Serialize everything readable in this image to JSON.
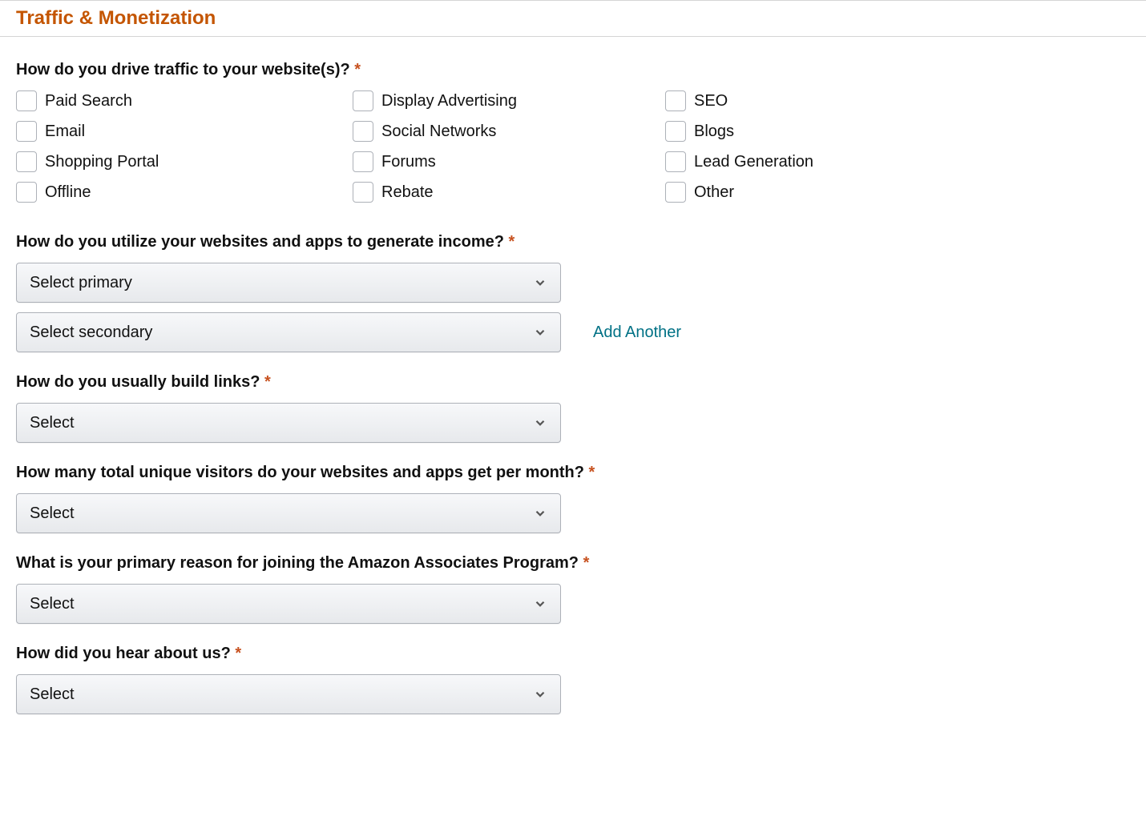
{
  "section": {
    "title": "Traffic & Monetization"
  },
  "traffic": {
    "question": "How do you drive traffic to your website(s)?",
    "required": "*",
    "options": [
      "Paid Search",
      "Display Advertising",
      "SEO",
      "Email",
      "Social Networks",
      "Blogs",
      "Shopping Portal",
      "Forums",
      "Lead Generation",
      "Offline",
      "Rebate",
      "Other"
    ]
  },
  "income": {
    "question": "How do you utilize your websites and apps to generate income?",
    "required": "*",
    "primary_placeholder": "Select primary",
    "secondary_placeholder": "Select secondary",
    "add_another": "Add Another"
  },
  "build_links": {
    "question": "How do you usually build links?",
    "required": "*",
    "placeholder": "Select"
  },
  "visitors": {
    "question": "How many total unique visitors do your websites and apps get per month?",
    "required": "*",
    "placeholder": "Select"
  },
  "reason": {
    "question": "What is your primary reason for joining the Amazon Associates Program?",
    "required": "*",
    "placeholder": "Select"
  },
  "hear": {
    "question": "How did you hear about us?",
    "required": "*",
    "placeholder": "Select"
  }
}
